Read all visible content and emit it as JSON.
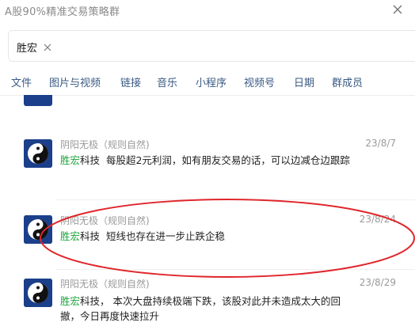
{
  "window": {
    "title": "A股90%精准交易策略群",
    "close_icon": "close-icon"
  },
  "search": {
    "keyword": "胜宏"
  },
  "tabs": [
    {
      "label": "文件"
    },
    {
      "label": "图片与视频"
    },
    {
      "label": "链接"
    },
    {
      "label": "音乐"
    },
    {
      "label": "小程序"
    },
    {
      "label": "视频号"
    },
    {
      "label": "日期"
    },
    {
      "label": "群成员"
    }
  ],
  "results": [
    {
      "sender": "阴阳无极（规则自然)",
      "date": "23/8/7",
      "highlight": "胜宏",
      "text": "科技  每股超2元利润，如有朋友交易的话，可以边减仓边跟踪",
      "avatar": "yin-yang-icon"
    },
    {
      "sender": "阴阳无极（规则自然)",
      "date": "23/8/24",
      "highlight": "胜宏",
      "text": "科技  短线也存在进一步止跌企稳",
      "avatar": "yin-yang-icon"
    },
    {
      "sender": "阴阳无极（规则自然)",
      "date": "23/8/29",
      "highlight": "胜宏",
      "text": "科技， 本次大盘持续极端下跌，该股对此并未造成太大的回撤，今日再度快速拉升",
      "avatar": "yin-yang-icon"
    }
  ],
  "annotation": {
    "shape": "ellipse",
    "color": "#e0262b",
    "target": "results.1"
  }
}
